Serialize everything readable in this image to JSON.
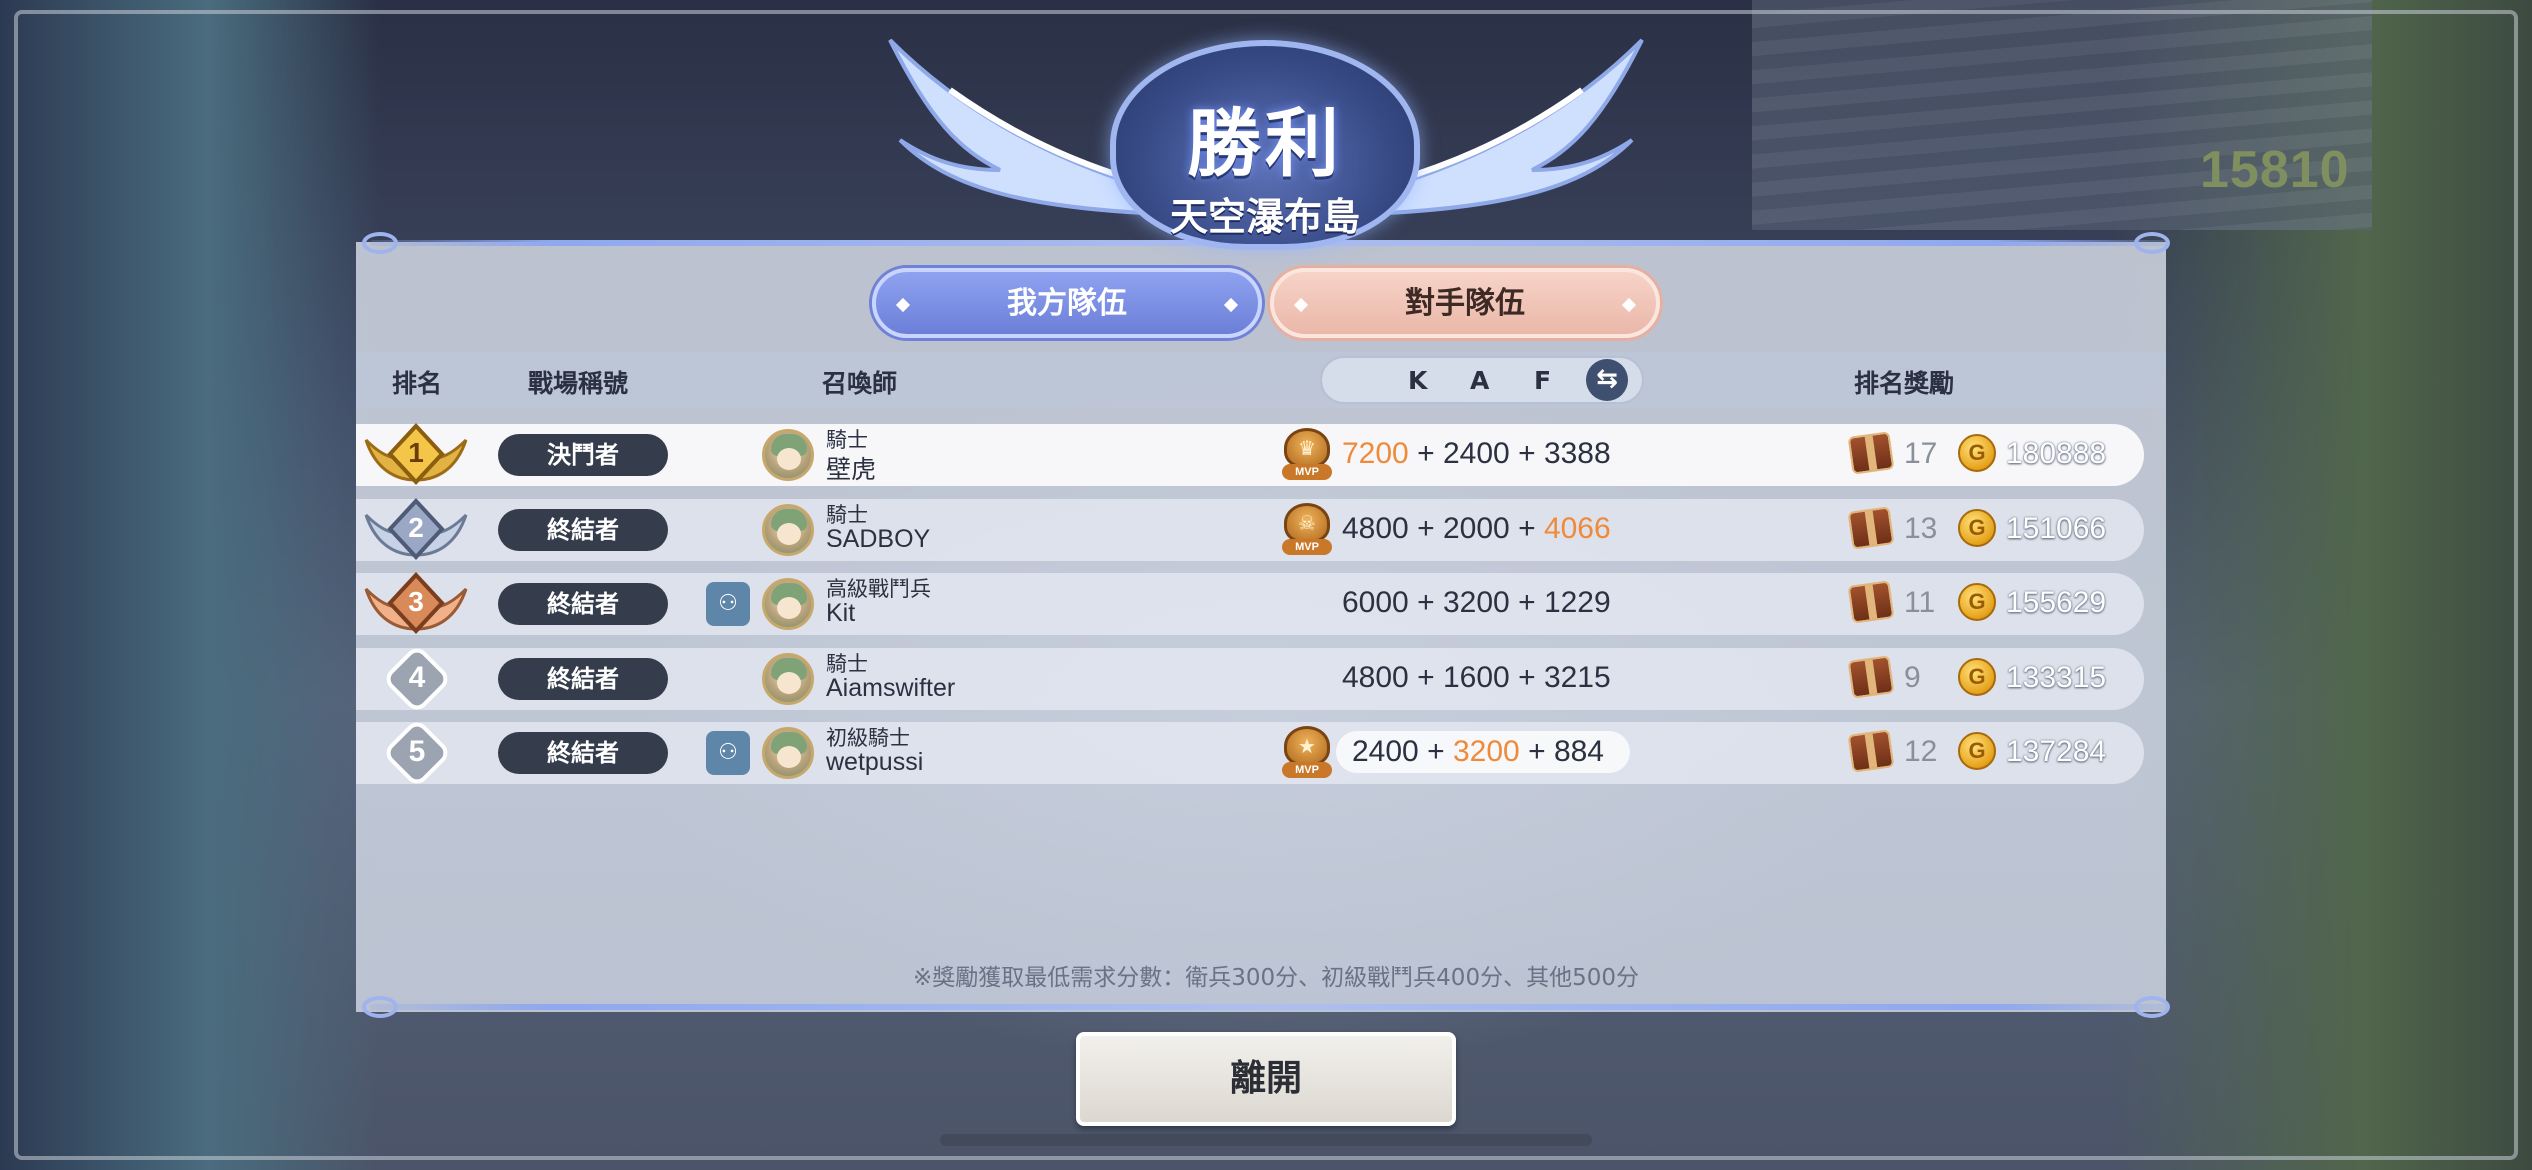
{
  "banner": {
    "title": "勝利",
    "map_name": "天空瀑布島"
  },
  "top_score": "15810",
  "tabs": {
    "our_team": "我方隊伍",
    "enemy_team": "對手隊伍"
  },
  "headers": {
    "rank": "排名",
    "battle_title": "戰場稱號",
    "summoner": "召喚師",
    "k": "K",
    "a": "A",
    "f": "F",
    "reward": "排名獎勵"
  },
  "rows": [
    {
      "rank": "1",
      "title": "決鬥者",
      "party": false,
      "class": "騎士",
      "name": "壁虎",
      "mvp": true,
      "k": "7200",
      "a": "2400",
      "f": "3388",
      "highlight": "k",
      "chests": "17",
      "gold": "180888"
    },
    {
      "rank": "2",
      "title": "終結者",
      "party": false,
      "class": "騎士",
      "name": "SADBOY",
      "mvp": true,
      "k": "4800",
      "a": "2000",
      "f": "4066",
      "highlight": "f",
      "chests": "13",
      "gold": "151066"
    },
    {
      "rank": "3",
      "title": "終結者",
      "party": true,
      "class": "高級戰鬥兵",
      "name": "Kit",
      "mvp": false,
      "k": "6000",
      "a": "3200",
      "f": "1229",
      "highlight": "",
      "chests": "11",
      "gold": "155629"
    },
    {
      "rank": "4",
      "title": "終結者",
      "party": false,
      "class": "騎士",
      "name": "Aiamswifter",
      "mvp": false,
      "k": "4800",
      "a": "1600",
      "f": "3215",
      "highlight": "",
      "chests": "9",
      "gold": "133315"
    },
    {
      "rank": "5",
      "title": "終結者",
      "party": true,
      "class": "初級騎士",
      "name": "wetpussi",
      "mvp": true,
      "k": "2400",
      "a": "3200",
      "f": "884",
      "highlight": "a",
      "chests": "12",
      "gold": "137284"
    }
  ],
  "plus": "+",
  "mvp_label": "MVP",
  "coin_symbol": "G",
  "footnote": "※獎勵獲取最低需求分數：衛兵300分、初級戰鬥兵400分、其他500分",
  "leave_button": "離開",
  "colors": {
    "highlight": "#ef8a3a",
    "tab_ours": "#6b7fd8",
    "tab_enemy": "#eab8a9"
  }
}
